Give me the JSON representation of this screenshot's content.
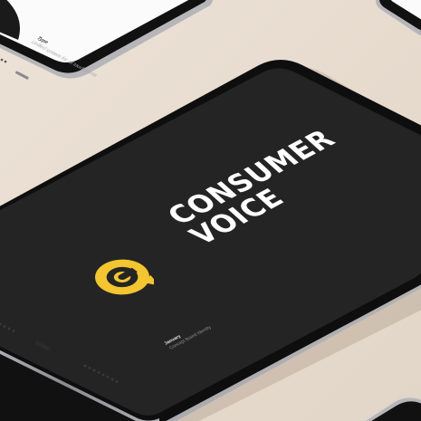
{
  "brand": {
    "line1": "CONSUMER",
    "line2": "VOICE",
    "accent_color": "#f2c531",
    "logo_icon": "speech-bubble-c-icon"
  },
  "main_tablet": {
    "footer_title": "January",
    "footer_subtitle": "Concept Brand Identity"
  },
  "top_left_tablet": {
    "footer_title": "Type",
    "footer_subtitle": "Unified system for all touchpoints"
  },
  "colors": {
    "background": "#e8ddd0",
    "screen_dark": "#232323",
    "screen_light": "#fbfbfb",
    "bezel": "#101010",
    "frame": "#b9b9bc"
  }
}
